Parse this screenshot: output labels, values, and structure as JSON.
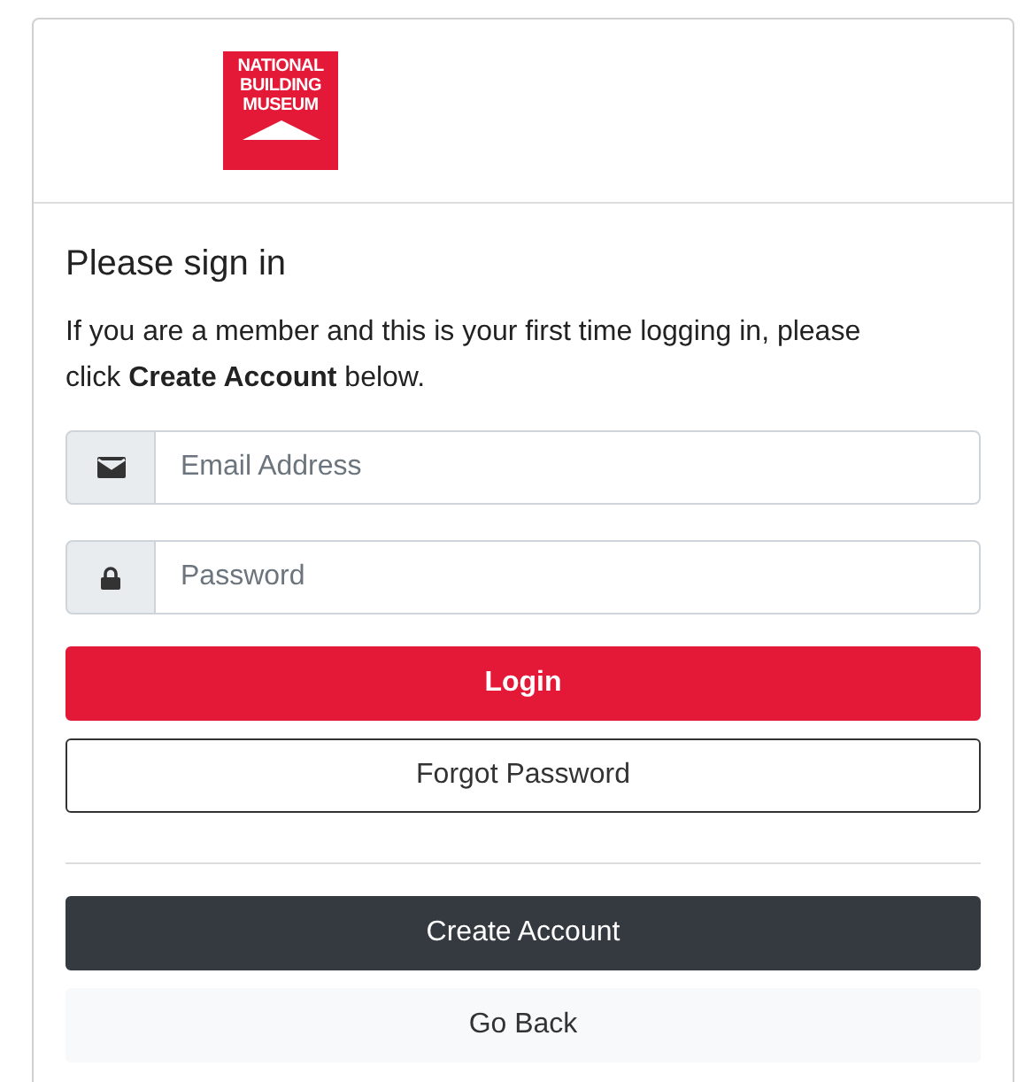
{
  "logo": {
    "lines": [
      "NATIONAL",
      "BUILDING",
      "MUSEUM"
    ]
  },
  "title": "Please sign in",
  "intro": "If you are a member and this is your first time logging in, please click **Create Account** below.",
  "fields": [
    {
      "kind": "email",
      "placeholder": "Email Address"
    },
    {
      "kind": "password",
      "placeholder": "Password"
    }
  ],
  "buttons": [
    {
      "kind": "primary",
      "label": "Login"
    },
    {
      "kind": "outline",
      "label": "Forgot Password"
    },
    {
      "kind": "divider"
    },
    {
      "kind": "dark",
      "label": "Create Account"
    },
    {
      "kind": "light",
      "label": "Go Back"
    }
  ]
}
